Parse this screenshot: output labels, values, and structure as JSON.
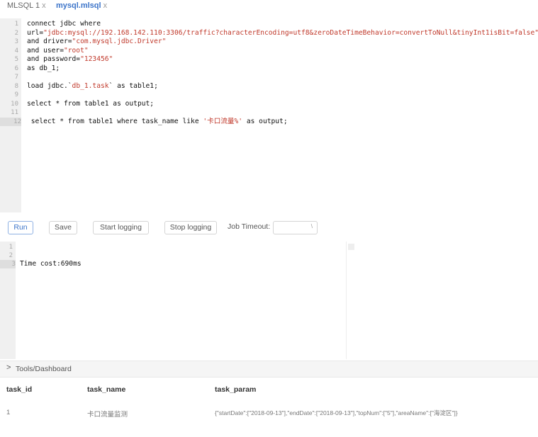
{
  "tabs": [
    {
      "label": "MLSQL 1",
      "close": "x"
    },
    {
      "label": "mysql.mlsql",
      "close": "x"
    }
  ],
  "editor": {
    "line_numbers": [
      "1",
      "2",
      "3",
      "4",
      "5",
      "6",
      "7",
      "8",
      "9",
      "10",
      "11",
      "12"
    ],
    "lines": [
      [
        {
          "t": "connect jdbc where"
        }
      ],
      [
        {
          "t": "url="
        },
        {
          "t": "\"jdbc:mysql://192.168.142.110:3306/traffic?characterEncoding=utf8&zeroDateTimeBehavior=convertToNull&tinyInt1isBit=false\"",
          "s": true
        }
      ],
      [
        {
          "t": "and driver="
        },
        {
          "t": "\"com.mysql.jdbc.Driver\"",
          "s": true
        }
      ],
      [
        {
          "t": "and user="
        },
        {
          "t": "\"root\"",
          "s": true
        }
      ],
      [
        {
          "t": "and password="
        },
        {
          "t": "\"123456\"",
          "s": true
        }
      ],
      [
        {
          "t": "as db_1;"
        }
      ],
      [
        {
          "t": ""
        }
      ],
      [
        {
          "t": "load jdbc.`"
        },
        {
          "t": "db_1.task",
          "s": true
        },
        {
          "t": "` as table1;"
        }
      ],
      [
        {
          "t": ""
        }
      ],
      [
        {
          "t": "select * from table1 as output;"
        }
      ],
      [
        {
          "t": ""
        }
      ],
      [
        {
          "t": " select * from table1 where task_name like "
        },
        {
          "t": "'卡口流量%'",
          "s": true
        },
        {
          "t": " as output;"
        }
      ]
    ]
  },
  "toolbar": {
    "run": "Run",
    "save": "Save",
    "start_logging": "Start logging",
    "stop_logging": "Stop logging",
    "job_timeout_label": "Job Timeout:",
    "job_timeout_value": ""
  },
  "output": {
    "line_numbers": [
      "1",
      "2",
      "3"
    ],
    "lines": [
      "",
      "",
      "Time cost:690ms"
    ]
  },
  "breadcrumb": {
    "chevron": ">",
    "label": "Tools/Dashboard"
  },
  "table": {
    "columns": [
      "task_id",
      "task_name",
      "task_param"
    ],
    "rows": [
      [
        "1",
        "卡口流量监测",
        "{\"startDate\":[\"2018-09-13\"],\"endDate\":[\"2018-09-13\"],\"topNum\":[\"5\"],\"areaName\":[\"海淀区\"]}"
      ]
    ]
  }
}
